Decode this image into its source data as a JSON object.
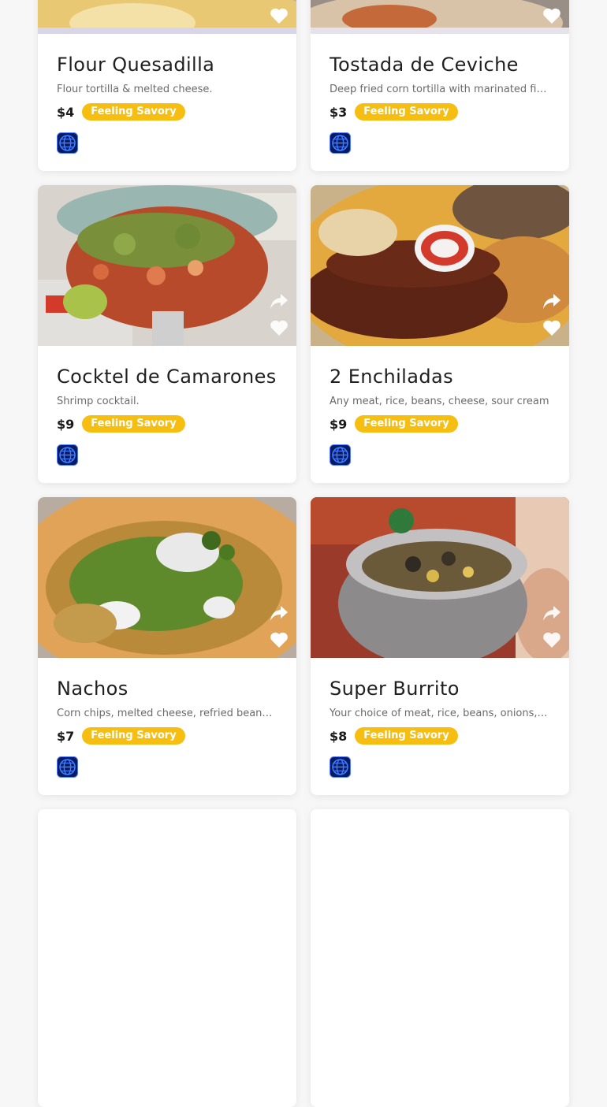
{
  "menu_items": [
    {
      "name": "Flour Quesadilla",
      "description": "Flour tortilla & melted cheese.",
      "price": "$4",
      "tag": "Feeling Savory"
    },
    {
      "name": "Tostada de Ceviche",
      "description": "Deep fried corn tortilla with marinated fish.",
      "price": "$3",
      "tag": "Feeling Savory"
    },
    {
      "name": "Cocktel de Camarones",
      "description": "Shrimp cocktail.",
      "price": "$9",
      "tag": "Feeling Savory"
    },
    {
      "name": "2 Enchiladas",
      "description": "Any meat, rice, beans, cheese, sour cream",
      "price": "$9",
      "tag": "Feeling Savory"
    },
    {
      "name": "Nachos",
      "description": "Corn chips, melted cheese, refried beans and",
      "price": "$7",
      "tag": "Feeling Savory"
    },
    {
      "name": "Super Burrito",
      "description": "Your choice of meat, rice, beans, onions, and",
      "price": "$8",
      "tag": "Feeling Savory"
    }
  ],
  "colors": {
    "tag_background": "#f7be12",
    "globe_blue": "#1f5fe0"
  },
  "icons": [
    "share-icon",
    "heart-icon",
    "globe-icon"
  ]
}
